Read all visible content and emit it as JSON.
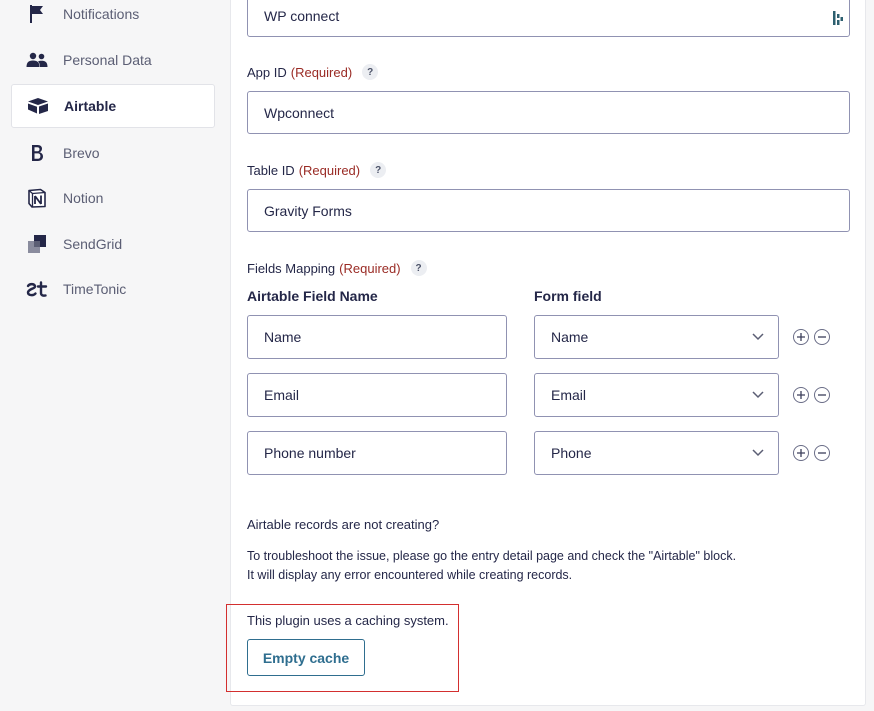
{
  "sidebar": {
    "items": [
      {
        "label": "Notifications",
        "icon": "flag-icon"
      },
      {
        "label": "Personal Data",
        "icon": "people-icon"
      },
      {
        "label": "Airtable",
        "icon": "airtable-icon",
        "active": true
      },
      {
        "label": "Brevo",
        "icon": "brevo-icon"
      },
      {
        "label": "Notion",
        "icon": "notion-icon"
      },
      {
        "label": "SendGrid",
        "icon": "sendgrid-icon"
      },
      {
        "label": "TimeTonic",
        "icon": "timetonic-icon"
      }
    ]
  },
  "form": {
    "feed_name_value": "WP connect",
    "app_id": {
      "label": "App ID",
      "required": "(Required)",
      "help": "?",
      "value": "Wpconnect"
    },
    "table_id": {
      "label": "Table ID",
      "required": "(Required)",
      "help": "?",
      "value": "Gravity Forms"
    },
    "fields_mapping": {
      "label": "Fields Mapping",
      "required": "(Required)",
      "help": "?",
      "col_airtable": "Airtable Field Name",
      "col_form": "Form field",
      "rows": [
        {
          "airtable_field": "Name",
          "form_field": "Name"
        },
        {
          "airtable_field": "Email",
          "form_field": "Email"
        },
        {
          "airtable_field": "Phone number",
          "form_field": "Phone"
        }
      ]
    },
    "troubleshoot": {
      "heading": "Airtable records are not creating?",
      "line1": "To troubleshoot the issue, please go the entry detail page and check the \"Airtable\" block.",
      "line2": "It will display any error encountered while creating records."
    },
    "cache": {
      "text": "This plugin uses a caching system.",
      "button": "Empty cache"
    }
  },
  "colors": {
    "required": "#9a2b25",
    "button": "#2f6e8f",
    "highlight": "#d32f2f",
    "border": "#9092b2"
  }
}
